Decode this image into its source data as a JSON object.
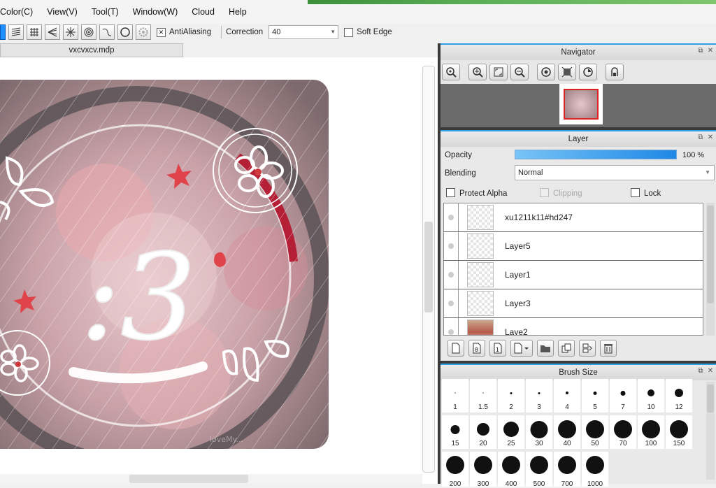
{
  "menu": [
    "Color(C)",
    "View(V)",
    "Tool(T)",
    "Window(W)",
    "Cloud",
    "Help"
  ],
  "toolbar": {
    "antialiasing_label": "AntiAliasing",
    "antialiasing_checked": true,
    "correction_label": "Correction",
    "correction_value": "40",
    "soft_edge_label": "Soft Edge",
    "soft_edge_checked": false,
    "ruler_icons": [
      "rect-fill-icon",
      "parallel-lines-icon",
      "grid-icon",
      "perspective-icon",
      "radial-lines-icon",
      "concentric-circles-icon",
      "curve-icon",
      "ellipse-icon",
      "gear-icon"
    ]
  },
  "document": {
    "tab_title": "vxcvxcv.mdp"
  },
  "artwork": {
    "text": ":3",
    "watermark": "loveMy..."
  },
  "navigator": {
    "title": "Navigator",
    "tools": [
      "zoom-fit-icon",
      "zoom-in-icon",
      "fit-screen-icon",
      "zoom-out-icon",
      "rotate-left-icon",
      "actual-size-icon",
      "rotate-right-icon",
      "flip-icon"
    ]
  },
  "layer": {
    "title": "Layer",
    "opacity_label": "Opacity",
    "opacity_value": "100 %",
    "opacity_fraction": 1.0,
    "blending_label": "Blending",
    "blending_value": "Normal",
    "protect_alpha_label": "Protect Alpha",
    "clipping_label": "Clipping",
    "lock_label": "Lock",
    "layers": [
      {
        "name": "xu1211k11#hd247",
        "thumb": "transparent"
      },
      {
        "name": "Layer5",
        "thumb": "transparent"
      },
      {
        "name": "Layer1",
        "thumb": "transparent"
      },
      {
        "name": "Layer3",
        "thumb": "transparent"
      },
      {
        "name": "Laye2",
        "thumb": "photo"
      }
    ]
  },
  "brush_size": {
    "title": "Brush Size",
    "sizes": [
      "1",
      "1.5",
      "2",
      "3",
      "4",
      "5",
      "7",
      "10",
      "12",
      "15",
      "20",
      "25",
      "30",
      "40",
      "50",
      "70",
      "100",
      "150",
      "200",
      "300",
      "400",
      "500",
      "700",
      "1000"
    ]
  }
}
